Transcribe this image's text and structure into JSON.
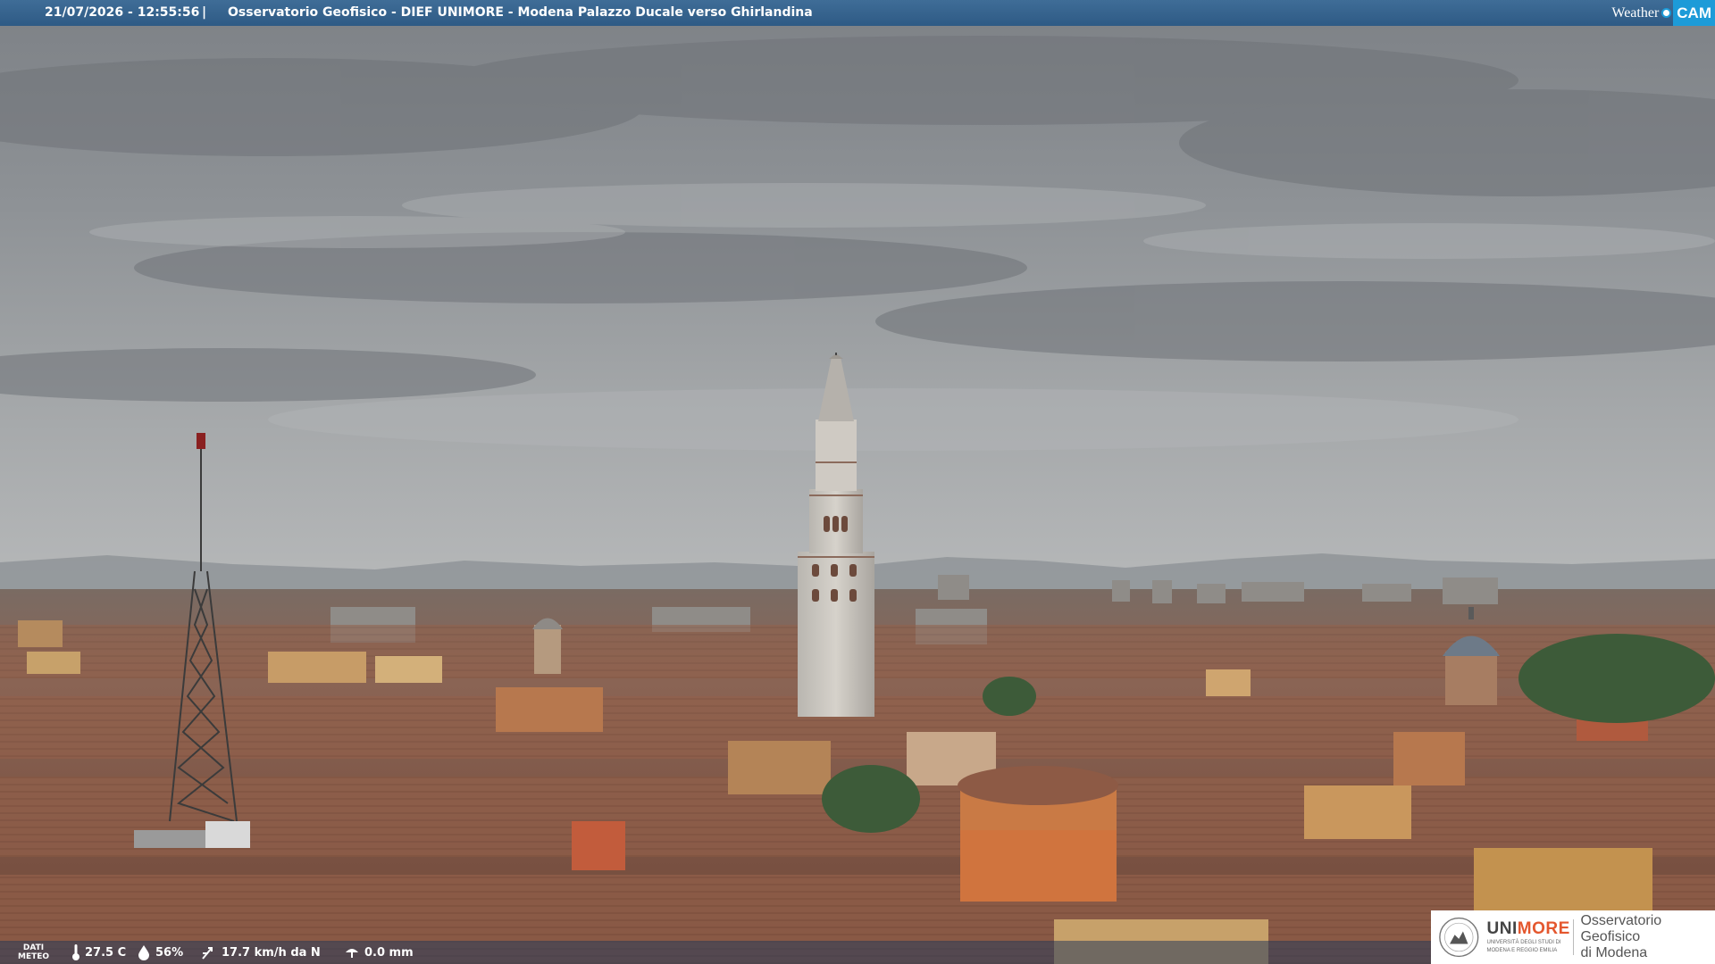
{
  "overlay": {
    "timestamp": "21/07/2026 - 12:55:56",
    "separator": "|",
    "title": "Osservatorio Geofisico - DIEF UNIMORE - Modena Palazzo Ducale verso Ghirlandina"
  },
  "weathercam_logo": {
    "weather": "Weather",
    "cam": "CAM"
  },
  "meteo": {
    "dati_label_line1": "DATI",
    "dati_label_line2": "METEO",
    "temperature": "27.5 C",
    "humidity": "56%",
    "wind": "17.7 km/h da N",
    "rain": "0.0 mm",
    "icons": [
      "thermometer-icon",
      "humidity-drop-icon",
      "wind-icon",
      "rain-gauge-icon"
    ]
  },
  "logo": {
    "unimore_prefix": "UNI",
    "unimore_accent": "MORE",
    "unimore_sub1": "UNIVERSITÀ DEGLI STUDI DI",
    "unimore_sub2": "MODENA E REGGIO EMILIA",
    "observatory_line1": "Osservatorio Geofisico",
    "observatory_line2": "di Modena"
  },
  "colors": {
    "topbar": "#2e5a85",
    "brand_blue": "#1d9bd8",
    "unimore_accent": "#e4572e",
    "sky": "#9a9ea1",
    "roofs": "#8c5a42"
  }
}
